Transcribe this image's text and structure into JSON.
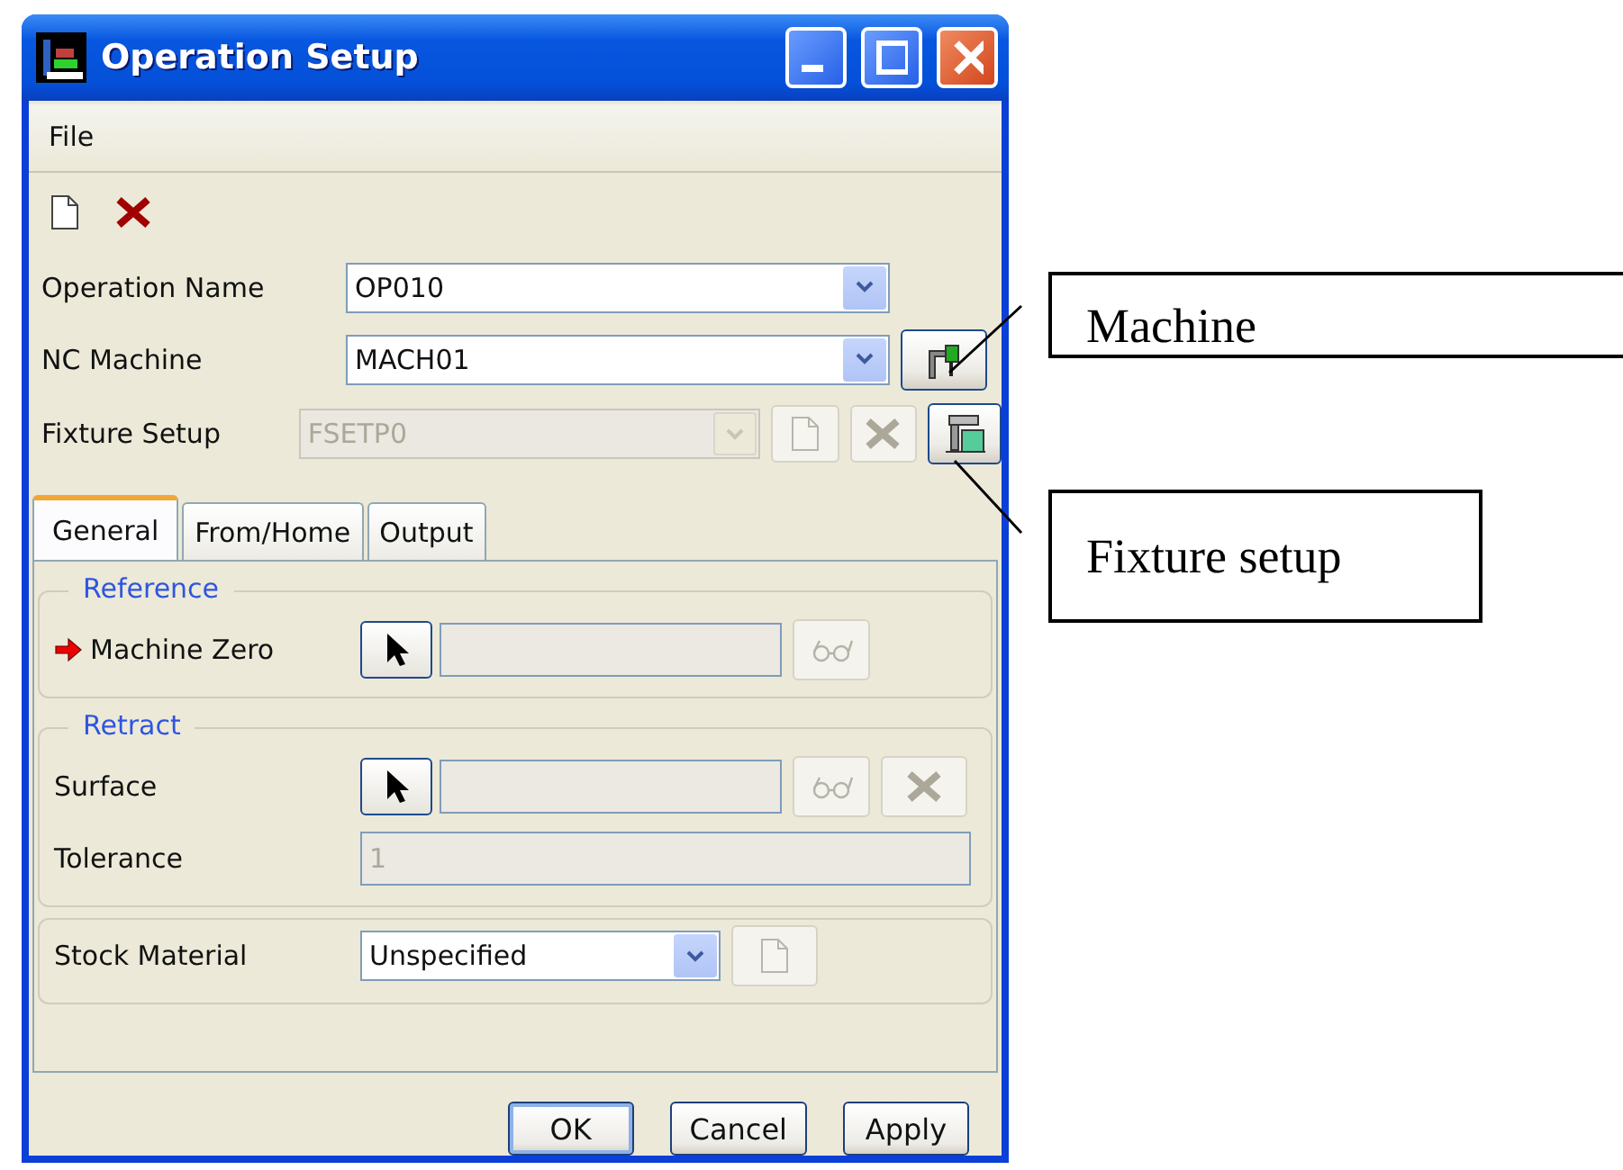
{
  "window": {
    "title": "Operation Setup"
  },
  "menu": [
    {
      "label": "File"
    }
  ],
  "fields": [
    {
      "label": "Operation Name",
      "value": "OP010",
      "disabled": false
    },
    {
      "label": "NC Machine",
      "value": "MACH01",
      "disabled": false,
      "actions": [
        {
          "kind": "machine",
          "disabled": false
        }
      ]
    },
    {
      "label": "Fixture Setup",
      "value": "FSETP0",
      "disabled": true,
      "actions": [
        {
          "kind": "new",
          "disabled": true
        },
        {
          "kind": "delete",
          "disabled": true
        },
        {
          "kind": "fixture",
          "disabled": false
        }
      ]
    }
  ],
  "tabs": [
    {
      "label": "General",
      "selected": true
    },
    {
      "label": "From/Home",
      "selected": false
    },
    {
      "label": "Output",
      "selected": false
    }
  ],
  "groups": [
    {
      "title": "Reference",
      "rows": [
        {
          "label": "Machine Zero",
          "kind": "pick",
          "required": true,
          "actions": [
            {
              "kind": "glasses",
              "disabled": true
            }
          ]
        }
      ]
    },
    {
      "title": "Retract",
      "rows": [
        {
          "label": "Surface",
          "kind": "pick",
          "required": false,
          "actions": [
            {
              "kind": "glasses",
              "disabled": true
            },
            {
              "kind": "delete",
              "disabled": true
            }
          ]
        },
        {
          "label": "Tolerance",
          "kind": "text",
          "value": "1",
          "disabled": true
        }
      ]
    },
    {
      "rows": [
        {
          "label": "Stock Material",
          "kind": "combo",
          "value": "Unspecified",
          "actions": [
            {
              "kind": "new",
              "disabled": true
            }
          ]
        }
      ]
    }
  ],
  "buttons": [
    {
      "label": "OK",
      "default": true
    },
    {
      "label": "Cancel",
      "default": false
    },
    {
      "label": "Apply",
      "default": false
    }
  ],
  "callouts": [
    {
      "text": "Machine"
    },
    {
      "text": "Fixture setup"
    }
  ]
}
